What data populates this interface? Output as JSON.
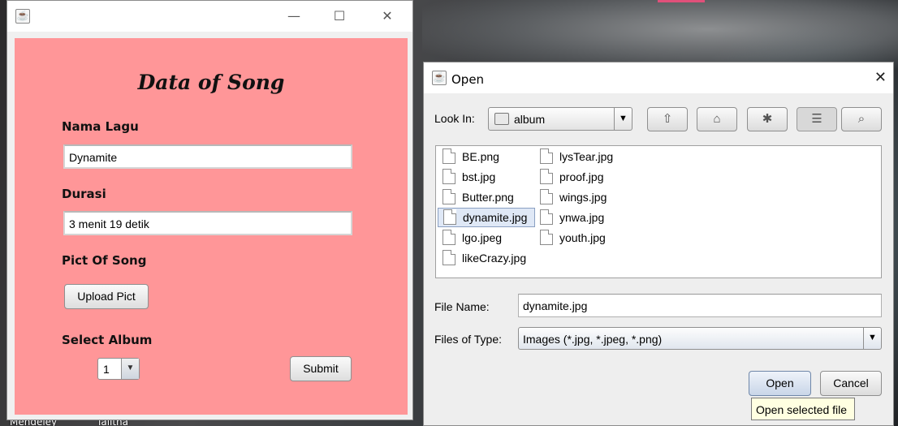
{
  "desktop": {
    "labels": [
      "Mendeley",
      "lalitha"
    ]
  },
  "main_window": {
    "title": "",
    "controls": {
      "minimize": "—",
      "maximize": "☐",
      "close": "✕"
    },
    "heading": "Data of Song",
    "nama_lagu_label": "Nama Lagu",
    "nama_lagu_value": "Dynamite",
    "durasi_label": "Durasi",
    "durasi_value": "3 menit 19 detik",
    "pict_label": "Pict Of Song",
    "upload_button": "Upload Pict",
    "album_label": "Select Album",
    "album_selected": "1",
    "submit_button": "Submit",
    "background_color": "#ff9698"
  },
  "open_dialog": {
    "title": "Open",
    "look_in_label": "Look In:",
    "look_in_value": "album",
    "toolbar_icons": [
      "up-folder-icon",
      "home-icon",
      "new-folder-icon",
      "list-view-icon",
      "details-view-icon"
    ],
    "files_col1": [
      "BE.png",
      "bst.jpg",
      "Butter.png",
      "dynamite.jpg",
      "lgo.jpeg",
      "likeCrazy.jpg"
    ],
    "files_col2": [
      "lysTear.jpg",
      "proof.jpg",
      "wings.jpg",
      "ynwa.jpg",
      "youth.jpg"
    ],
    "selected_file": "dynamite.jpg",
    "file_name_label": "File Name:",
    "file_name_value": "dynamite.jpg",
    "files_of_type_label": "Files of Type:",
    "files_of_type_value": "Images (*.jpg, *.jpeg, *.png)",
    "open_button": "Open",
    "cancel_button": "Cancel",
    "tooltip": "Open selected file"
  }
}
